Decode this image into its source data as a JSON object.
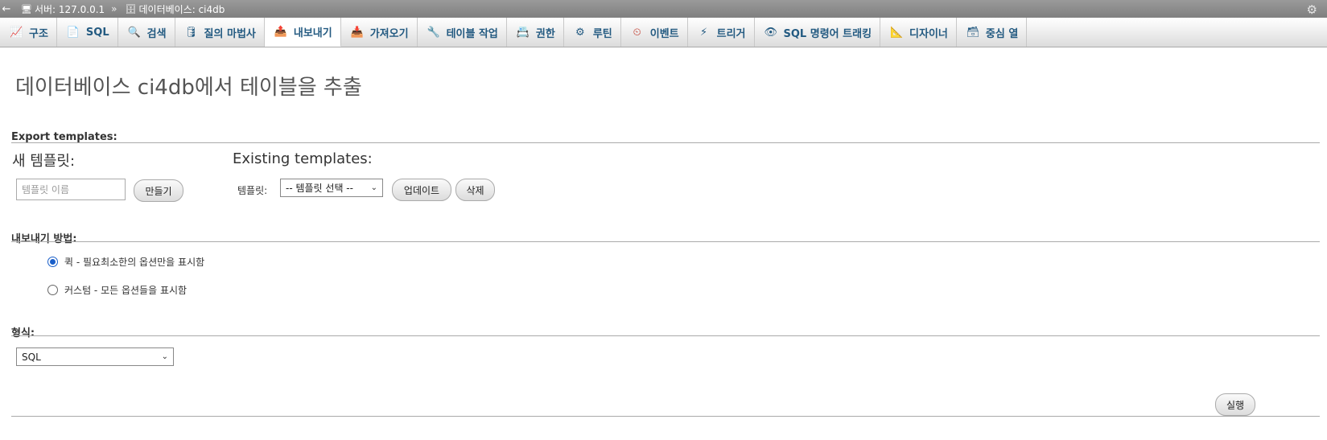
{
  "breadcrumb": {
    "back_icon": "arrow-left-icon",
    "server_label": "서버: 127.0.0.1",
    "separator": "»",
    "database_label": "데이터베이스: ci4db",
    "settings_icon": "gear-icon"
  },
  "tabs": [
    {
      "label": "구조",
      "icon": "structure-icon"
    },
    {
      "label": "SQL",
      "icon": "sql-icon"
    },
    {
      "label": "검색",
      "icon": "search-icon"
    },
    {
      "label": "질의 마법사",
      "icon": "query-icon"
    },
    {
      "label": "내보내기",
      "icon": "export-icon",
      "active": true
    },
    {
      "label": "가져오기",
      "icon": "import-icon"
    },
    {
      "label": "테이블 작업",
      "icon": "wrench-icon"
    },
    {
      "label": "권한",
      "icon": "privileges-icon"
    },
    {
      "label": "루틴",
      "icon": "routines-icon"
    },
    {
      "label": "이벤트",
      "icon": "clock-icon"
    },
    {
      "label": "트리거",
      "icon": "triggers-icon"
    },
    {
      "label": "SQL 명령어 트래킹",
      "icon": "eye-icon"
    },
    {
      "label": "디자이너",
      "icon": "designer-icon"
    },
    {
      "label": "중심 열",
      "icon": "central-columns-icon"
    }
  ],
  "page": {
    "title": "데이터베이스 ci4db에서 테이블을 추출"
  },
  "templates": {
    "section_label": "Export templates:",
    "new_heading": "새 템플릿:",
    "name_placeholder": "템플릿 이름",
    "create_button": "만들기",
    "existing_heading": "Existing templates:",
    "template_label": "템플릿:",
    "template_select_value": "-- 템플릿 선택 --",
    "update_button": "업데이트",
    "delete_button": "삭제"
  },
  "method": {
    "section_label": "내보내기 방법:",
    "quick_label": "퀵 - 필요최소한의 옵션만을 표시함",
    "quick_checked": true,
    "custom_label": "커스텀 - 모든 옵션들을 표시함",
    "custom_checked": false
  },
  "format": {
    "section_label": "형식:",
    "selected": "SQL"
  },
  "actions": {
    "go_button": "실행"
  }
}
